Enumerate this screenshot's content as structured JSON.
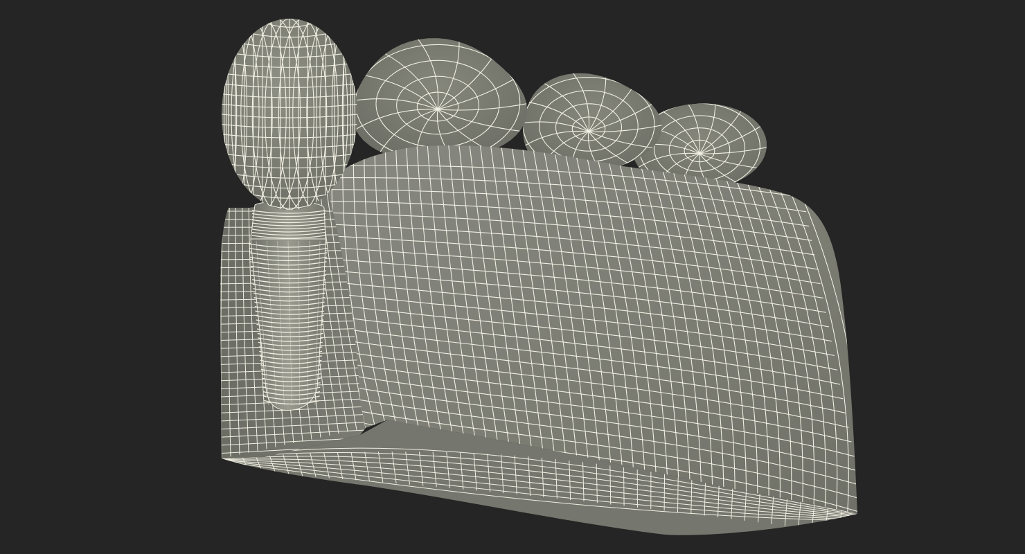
{
  "scene": {
    "subject": "",
    "colors": {
      "background": "#252525",
      "surface": "#7d7e73",
      "surface_light": "#8e8f83",
      "surface_dark": "#686a60",
      "wire": "#f2f0e4"
    },
    "parts": [
      "crown",
      "implant-screw",
      "molar-crown-1",
      "molar-crown-2",
      "molar-crown-3",
      "gum-block",
      "cut-face",
      "bottom-face"
    ]
  }
}
